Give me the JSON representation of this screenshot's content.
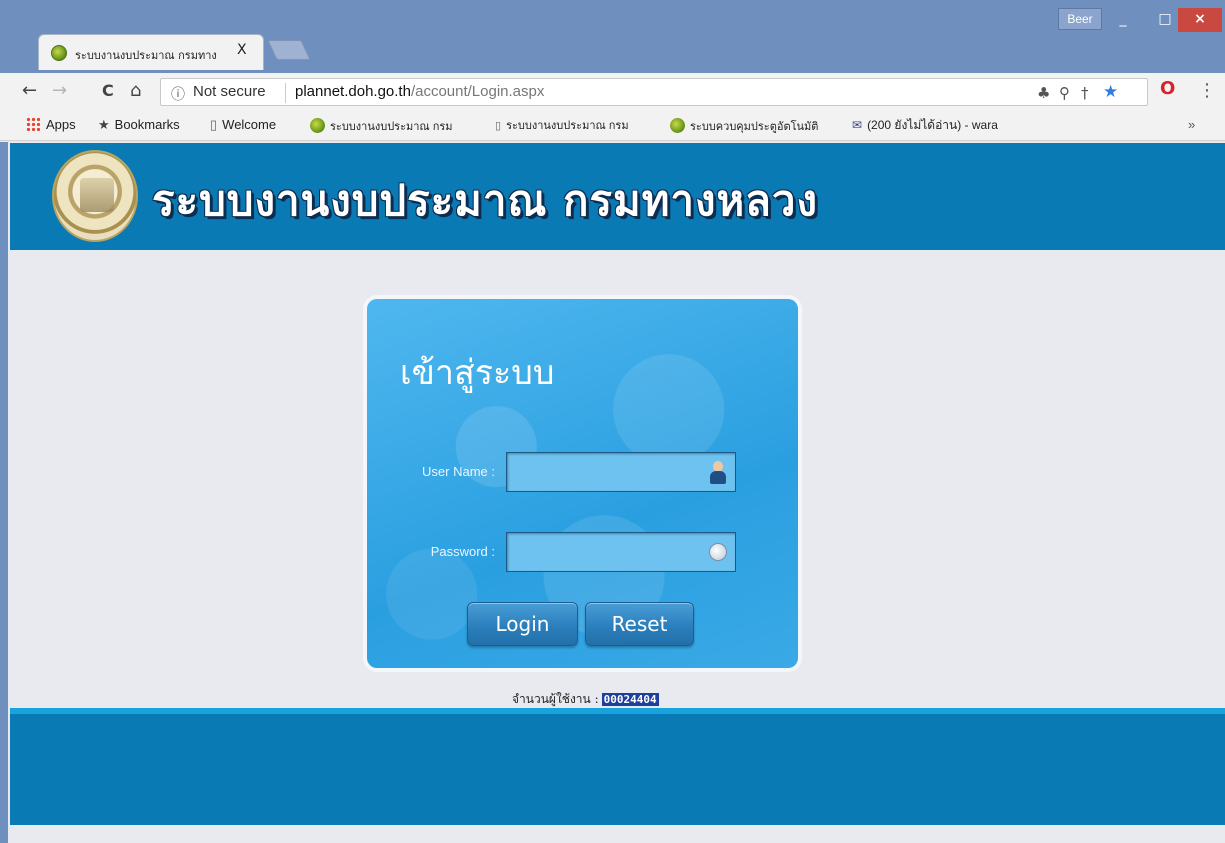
{
  "window": {
    "profile_name": "Beer",
    "minimize": "_",
    "maximize": "□",
    "close": "×"
  },
  "tab": {
    "title": "ระบบงานงบประมาณ กรมทาง",
    "close": "X"
  },
  "toolbar": {
    "back": "←",
    "forward": "→",
    "reload": "C",
    "home": "⌂",
    "info_icon": "ⓘ",
    "security_label": "Not secure",
    "url_host": "plannet.doh.go.th",
    "url_path": "/account/Login.aspx",
    "menu": "⋮"
  },
  "bookmarks": {
    "items": [
      {
        "label": "Apps",
        "icon": "apps-grid-icon"
      },
      {
        "label": "Bookmarks",
        "icon": "star-icon"
      },
      {
        "label": "Welcome",
        "icon": "page-icon"
      },
      {
        "label": "ระบบงานงบประมาณ กรม",
        "icon": "site-icon"
      },
      {
        "label": "ระบบงานงบประมาณ กรม",
        "icon": "page-icon"
      },
      {
        "label": "ระบบควบคุมประตูอัตโนมัติ",
        "icon": "site-icon"
      },
      {
        "label": "(200 ยังไม่ได้อ่าน) - wara",
        "icon": "mail-icon"
      }
    ],
    "overflow": "»"
  },
  "page": {
    "site_title": "ระบบงานงบประมาณ กรมทางหลวง",
    "login_title": "เข้าสู่ระบบ",
    "username_label": "User Name :",
    "password_label": "Password :",
    "login_button": "Login",
    "reset_button": "Reset",
    "counter_label": "จำนวนผู้ใช้งาน :",
    "counter_value": "00024404"
  },
  "colors": {
    "header": "#0a7ab5",
    "panel": "#2a9fe0",
    "counter_bg": "#1f3f9e"
  }
}
